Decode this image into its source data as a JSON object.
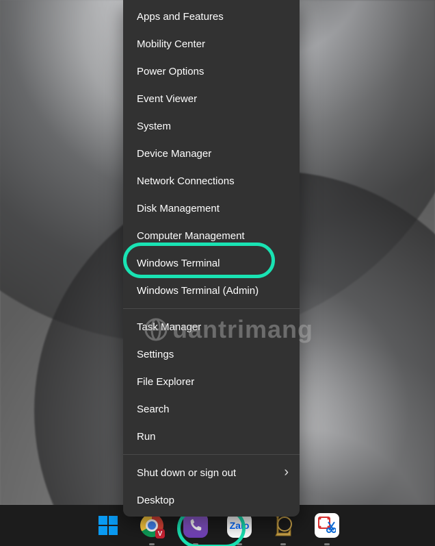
{
  "colors": {
    "menu_bg": "#323232",
    "accent_highlight": "#19e3b3",
    "taskbar_bg": "#1c1c1c",
    "win_blue": "#0a9bf4"
  },
  "winx_menu": {
    "groups": [
      {
        "items": [
          {
            "label": "Apps and Features"
          },
          {
            "label": "Mobility Center"
          },
          {
            "label": "Power Options"
          },
          {
            "label": "Event Viewer"
          },
          {
            "label": "System"
          },
          {
            "label": "Device Manager"
          },
          {
            "label": "Network Connections"
          },
          {
            "label": "Disk Management"
          },
          {
            "label": "Computer Management"
          },
          {
            "label": "Windows Terminal",
            "highlighted": true
          },
          {
            "label": "Windows Terminal (Admin)"
          }
        ]
      },
      {
        "items": [
          {
            "label": "Task Manager"
          },
          {
            "label": "Settings"
          },
          {
            "label": "File Explorer"
          },
          {
            "label": "Search"
          },
          {
            "label": "Run"
          }
        ]
      },
      {
        "items": [
          {
            "label": "Shut down or sign out",
            "submenu": true
          },
          {
            "label": "Desktop"
          }
        ]
      }
    ]
  },
  "watermark": {
    "text": "uantrimang"
  },
  "taskbar": {
    "items": [
      {
        "name": "start",
        "icon": "windows-logo-icon",
        "highlighted": true,
        "running": false
      },
      {
        "name": "chrome",
        "icon": "chrome-icon",
        "badge": "V",
        "running": true
      },
      {
        "name": "viber",
        "icon": "viber-icon",
        "running": true
      },
      {
        "name": "zalo",
        "icon": "zalo-icon",
        "label": "Zalo",
        "running": true
      },
      {
        "name": "league-of-legends",
        "icon": "lol-icon",
        "running": true
      },
      {
        "name": "snipping-tool",
        "icon": "scissors-icon",
        "running": true
      }
    ]
  }
}
